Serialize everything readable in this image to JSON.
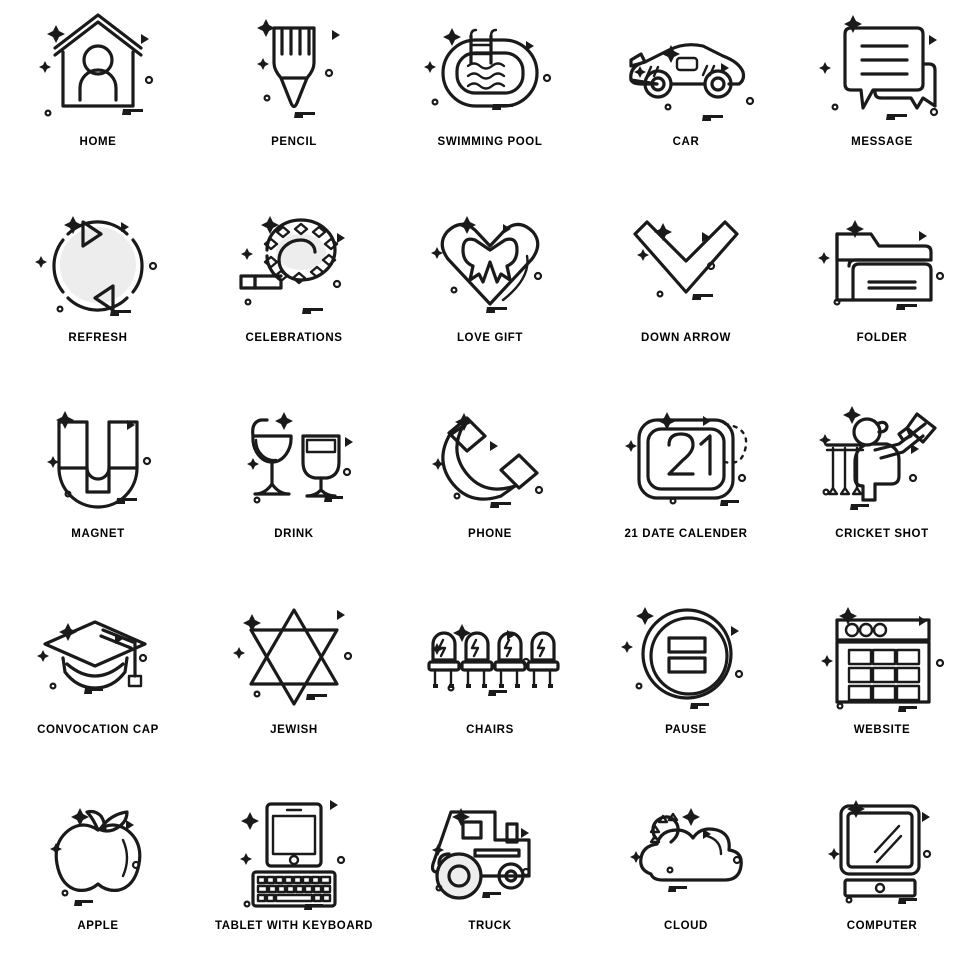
{
  "page": {
    "background_color": "#ffffff",
    "line_color": "#1a1a1a",
    "fill_accent_color": "#ededed",
    "grid": {
      "columns": 5,
      "rows": 5,
      "total_icons": 25
    }
  },
  "icons": [
    {
      "label": "HOME",
      "icon_name": "home-icon"
    },
    {
      "label": "PENCIL",
      "icon_name": "pencil-icon"
    },
    {
      "label": "SWIMMING POOL",
      "icon_name": "swimming-pool-icon"
    },
    {
      "label": "CAR",
      "icon_name": "car-icon"
    },
    {
      "label": "MESSAGE",
      "icon_name": "message-icon"
    },
    {
      "label": "REFRESH",
      "icon_name": "refresh-icon"
    },
    {
      "label": "CELEBRATIONS",
      "icon_name": "celebrations-icon"
    },
    {
      "label": "LOVE GIFT",
      "icon_name": "love-gift-icon"
    },
    {
      "label": "DOWN ARROW",
      "icon_name": "down-arrow-icon"
    },
    {
      "label": "FOLDER",
      "icon_name": "folder-icon"
    },
    {
      "label": "MAGNET",
      "icon_name": "magnet-icon"
    },
    {
      "label": "DRINK",
      "icon_name": "drink-icon"
    },
    {
      "label": "PHONE",
      "icon_name": "phone-icon"
    },
    {
      "label": "21 DATE CALENDER",
      "icon_name": "calendar-21-icon"
    },
    {
      "label": "CRICKET SHOT",
      "icon_name": "cricket-shot-icon"
    },
    {
      "label": "CONVOCATION CAP",
      "icon_name": "convocation-cap-icon"
    },
    {
      "label": "JEWISH",
      "icon_name": "jewish-star-icon"
    },
    {
      "label": "CHAIRS",
      "icon_name": "chairs-icon"
    },
    {
      "label": "PAUSE",
      "icon_name": "pause-icon"
    },
    {
      "label": "WEBSITE",
      "icon_name": "website-icon"
    },
    {
      "label": "APPLE",
      "icon_name": "apple-icon"
    },
    {
      "label": "TABLET WITH KEYBOARD",
      "icon_name": "tablet-with-keyboard-icon"
    },
    {
      "label": "TRUCK",
      "icon_name": "truck-icon"
    },
    {
      "label": "CLOUD",
      "icon_name": "cloud-icon"
    },
    {
      "label": "COMPUTER",
      "icon_name": "computer-icon"
    }
  ],
  "calendar_day_number": "21"
}
